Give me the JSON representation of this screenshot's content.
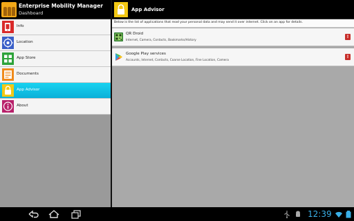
{
  "app": {
    "title": "Enterprise Mobility Manager",
    "subtitle": "Dashboard"
  },
  "sidebar": {
    "items": [
      {
        "label": "Info",
        "icon": "info-device-icon",
        "color": "#d92a2a",
        "active": false
      },
      {
        "label": "Location",
        "icon": "location-icon",
        "color": "#3a5fc8",
        "active": false
      },
      {
        "label": "App Store",
        "icon": "app-store-icon",
        "color": "#2ea33a",
        "active": false
      },
      {
        "label": "Documents",
        "icon": "documents-icon",
        "color": "#f08a1a",
        "active": false
      },
      {
        "label": "App Advisor",
        "icon": "lock-icon",
        "color": "#f2c814",
        "active": true
      },
      {
        "label": "About",
        "icon": "about-icon",
        "color": "#b8206a",
        "active": false
      }
    ]
  },
  "main": {
    "title": "App Advisor",
    "description": "Below is the list of applications that read your personal data and may send it over internet. Click on an app for details.",
    "apps": [
      {
        "name": "QR Droid",
        "permissions": "Internet, Camera, Contacts, Bookmarks/History",
        "icon": "qr-droid-icon",
        "badge": "!"
      },
      {
        "name": "Google Play services",
        "permissions": "Accounts, Internet, Contacts, Coarse Location, Fine Location, Camera",
        "icon": "play-services-icon",
        "badge": "!"
      }
    ]
  },
  "system_bar": {
    "clock": "12:39",
    "accent": "#3ab0e8"
  }
}
